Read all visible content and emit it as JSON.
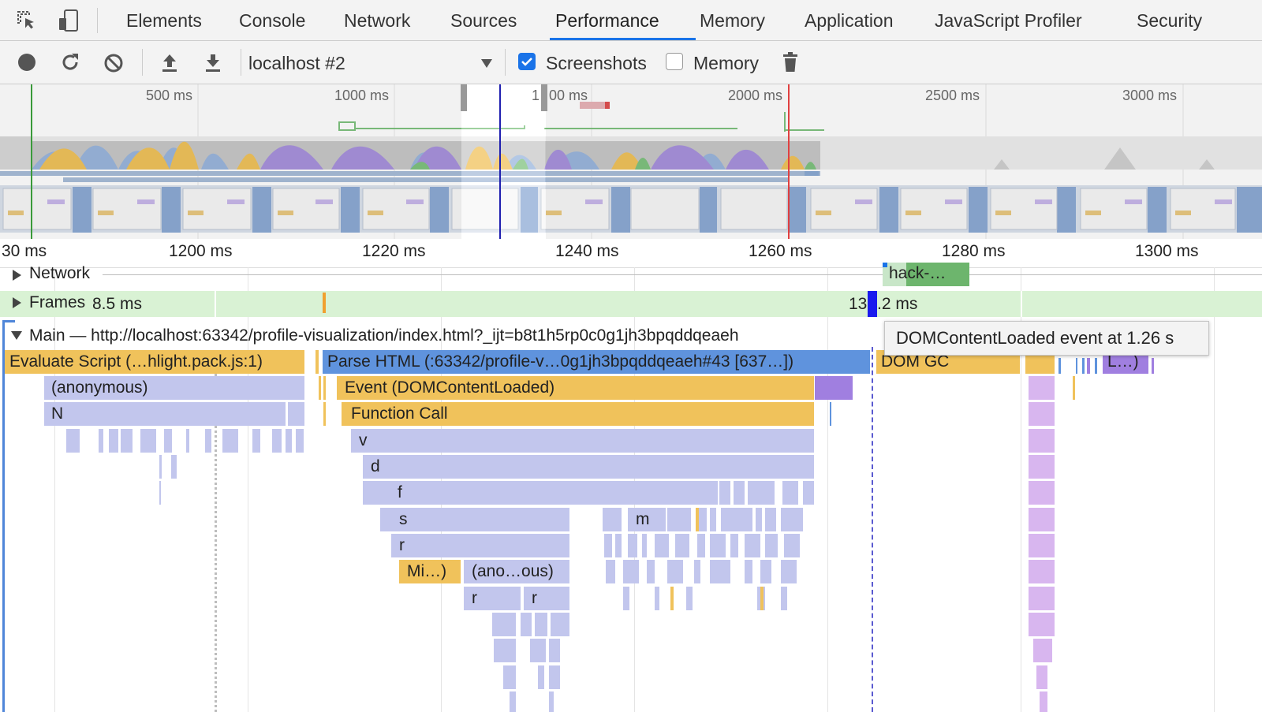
{
  "tabs": {
    "items": [
      "Elements",
      "Console",
      "Network",
      "Sources",
      "Performance",
      "Memory",
      "Application",
      "JavaScript Profiler",
      "Security"
    ],
    "active": "Performance"
  },
  "toolbar": {
    "profile_select": "localhost #2",
    "screenshots_label": "Screenshots",
    "screenshots_checked": true,
    "memory_label": "Memory",
    "memory_checked": false
  },
  "overview": {
    "labels": [
      "500 ms",
      "1000 ms",
      "1",
      "00 ms",
      "2000 ms",
      "2500 ms",
      "3000 ms"
    ]
  },
  "ruler": {
    "labels": [
      "30 ms",
      "1200 ms",
      "1220 ms",
      "1240 ms",
      "1260 ms",
      "1280 ms",
      "1300 ms"
    ]
  },
  "tracks": {
    "network_label": "Network",
    "network_request": "hack-…",
    "frames_label": "Frames",
    "frame_time_1": "8.5 ms",
    "frame_time_2a": "13",
    "frame_time_2b": ".2 ms",
    "main_label": "Main — http://localhost:63342/profile-visualization/index.html?_ijt=b8t1h5rp0c0g1jh3bpqddqeaeh"
  },
  "flame": {
    "evaluate_script": "Evaluate Script (…hlight.pack.js:1)",
    "parse_html": "Parse HTML (:63342/profile-v…0g1jh3bpqddqeaeh#43 [637…])",
    "dom_gc": "DOM GC",
    "l_short": "L…)",
    "anonymous": "(anonymous)",
    "event_dcl": "Event (DOMContentLoaded)",
    "n": "N",
    "function_call": "Function Call",
    "v": "v",
    "d": "d",
    "f": "f",
    "s": "s",
    "m": "m",
    "r": "r",
    "mi": "Mi…)",
    "ano_ous": "(ano…ous)",
    "r2": "r",
    "r3": "r"
  },
  "tooltip": "DOMContentLoaded event at 1.26 s",
  "colors": {
    "accent": "#1a73e8",
    "scripting": "#f0c25b",
    "loading": "#5f93dd",
    "rendering": "#a07fe0",
    "js_frame": "#c2c6ed",
    "frames_bg": "#d9f2d4",
    "network_bar": "#6db56d"
  }
}
